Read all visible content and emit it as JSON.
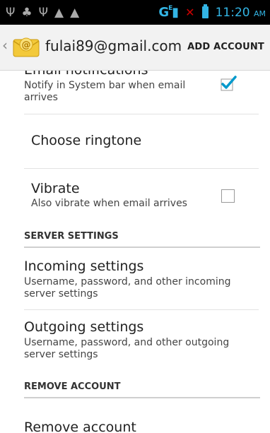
{
  "status_bar": {
    "network_label": "G",
    "time": "11:20",
    "ampm": "AM"
  },
  "action_bar": {
    "title": "fulai89@gmail.com",
    "action_label": "ADD ACCOUNT"
  },
  "prefs": {
    "email_notifications": {
      "title": "Email notifications",
      "summary": "Notify in System bar when email arrives",
      "checked": true
    },
    "choose_ringtone": {
      "title": "Choose ringtone"
    },
    "vibrate": {
      "title": "Vibrate",
      "summary": "Also vibrate when email arrives",
      "checked": false
    },
    "server_settings_header": "SERVER SETTINGS",
    "incoming_settings": {
      "title": "Incoming settings",
      "summary": "Username, password, and other incoming server settings"
    },
    "outgoing_settings": {
      "title": "Outgoing settings",
      "summary": "Username, password, and other outgoing server settings"
    },
    "remove_account_header": "REMOVE ACCOUNT",
    "remove_account": {
      "title": "Remove account"
    }
  },
  "colors": {
    "status_accent": "#33b5e5",
    "status_alert": "#cc0000",
    "check_blue": "#0099cc"
  }
}
